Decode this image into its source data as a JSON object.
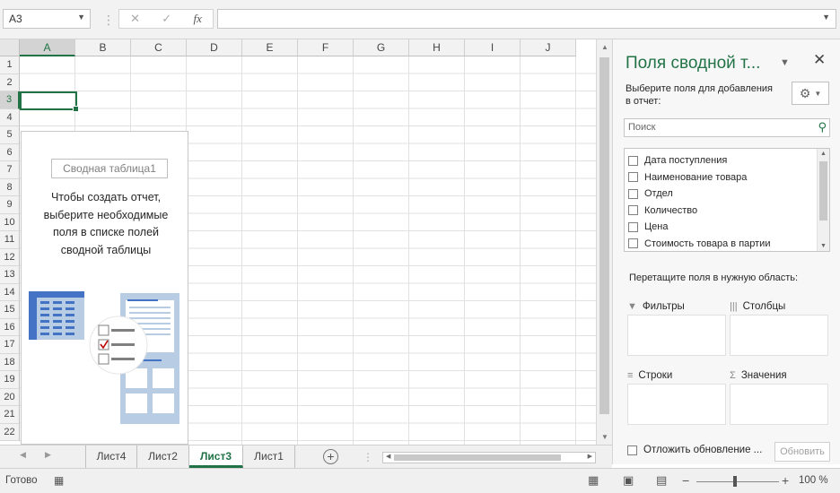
{
  "formula_bar": {
    "name_box": "A3",
    "cancel_icon": "✕",
    "enter_icon": "✓",
    "fx_label": "fx",
    "formula_value": ""
  },
  "grid": {
    "columns": [
      "A",
      "B",
      "C",
      "D",
      "E",
      "F",
      "G",
      "H",
      "I",
      "J"
    ],
    "rows": [
      "1",
      "2",
      "3",
      "4",
      "5",
      "6",
      "7",
      "8",
      "9",
      "10",
      "11",
      "12",
      "13",
      "14",
      "15",
      "16",
      "17",
      "18",
      "19",
      "20",
      "21",
      "22"
    ],
    "selected_column": "A",
    "selected_row": "3"
  },
  "pivot_placeholder": {
    "name": "Сводная таблица1",
    "hint": [
      "Чтобы создать отчет,",
      "выберите необходимые",
      "поля в списке полей",
      "сводной таблицы"
    ]
  },
  "panel": {
    "title": "Поля сводной т...",
    "close_icon": "✕",
    "choose_label": "Выберите поля для добавления в отчет:",
    "search_placeholder": "Поиск",
    "fields": [
      {
        "label": "Дата поступления",
        "checked": false
      },
      {
        "label": "Наименование товара",
        "checked": false
      },
      {
        "label": "Отдел",
        "checked": false
      },
      {
        "label": "Количество",
        "checked": false
      },
      {
        "label": "Цена",
        "checked": false
      },
      {
        "label": "Стоимость товара в партии",
        "checked": false
      }
    ],
    "drag_label": "Перетащите поля в нужную область:",
    "areas": {
      "filters": "Фильтры",
      "columns": "Столбцы",
      "rows": "Строки",
      "values": "Значения"
    },
    "defer_label": "Отложить обновление ...",
    "update_button": "Обновить"
  },
  "sheets": {
    "tabs": [
      "Лист4",
      "Лист2",
      "Лист3",
      "Лист1"
    ],
    "active": "Лист3",
    "add_icon": "+"
  },
  "status_bar": {
    "status": "Готово",
    "zoom_minus": "−",
    "zoom_plus": "+",
    "zoom_level": "100 %",
    "zoom_percent": 100
  },
  "colors": {
    "accent": "#217346",
    "illustration_blue": "#b8cce4",
    "illustration_dark": "#4472c4"
  }
}
